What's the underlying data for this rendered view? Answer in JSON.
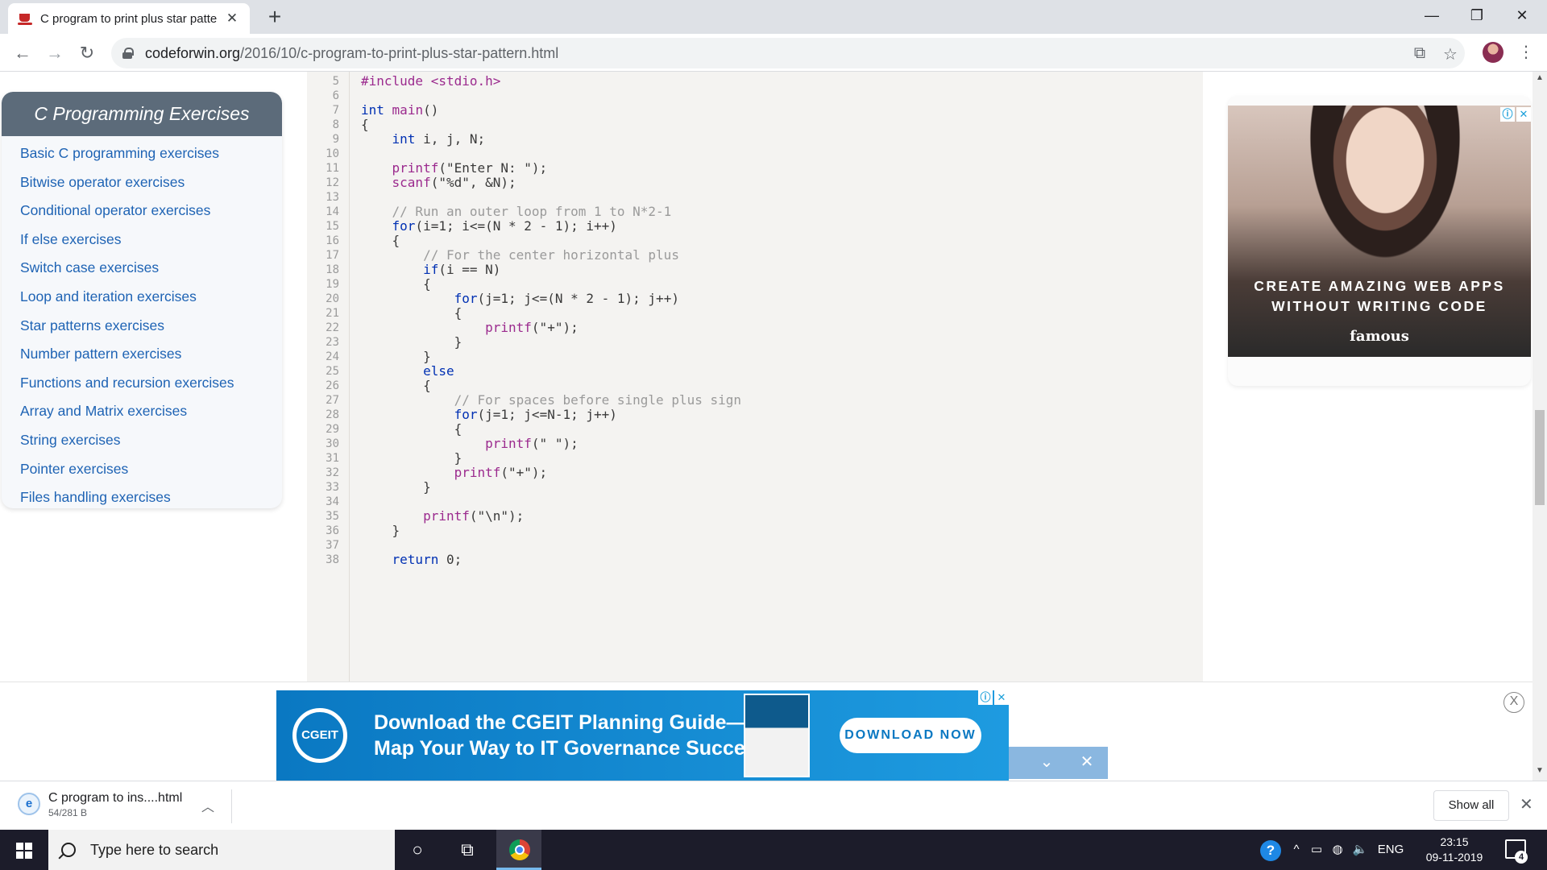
{
  "browser": {
    "tab_title": "C program to print plus star patte",
    "new_tab": "+",
    "url_domain": "codeforwin.org",
    "url_path": "/2016/10/c-program-to-print-plus-star-pattern.html",
    "minimize": "—",
    "maximize": "❐",
    "close": "✕"
  },
  "sidebar": {
    "title": "C Programming Exercises",
    "items": [
      {
        "label": "Basic C programming exercises"
      },
      {
        "label": "Bitwise operator exercises"
      },
      {
        "label": "Conditional operator exercises"
      },
      {
        "label": "If else exercises"
      },
      {
        "label": "Switch case exercises"
      },
      {
        "label": "Loop and iteration exercises"
      },
      {
        "label": "Star patterns exercises"
      },
      {
        "label": "Number pattern exercises"
      },
      {
        "label": "Functions and recursion exercises"
      },
      {
        "label": "Array and Matrix exercises"
      },
      {
        "label": "String exercises"
      },
      {
        "label": "Pointer exercises"
      },
      {
        "label": "Files handling exercises"
      }
    ]
  },
  "code": {
    "lines": [
      {
        "n": "5",
        "text": "#include <stdio.h>",
        "kind": "fn"
      },
      {
        "n": "6",
        "text": "",
        "kind": "plain"
      },
      {
        "n": "7",
        "text": "int main()",
        "kind": "main"
      },
      {
        "n": "8",
        "text": "{",
        "kind": "plain"
      },
      {
        "n": "9",
        "text": "    int i, j, N;",
        "kind": "decl"
      },
      {
        "n": "10",
        "text": "",
        "kind": "plain"
      },
      {
        "n": "11",
        "text": "    printf(\"Enter N: \");",
        "kind": "call"
      },
      {
        "n": "12",
        "text": "    scanf(\"%d\", &N);",
        "kind": "call"
      },
      {
        "n": "13",
        "text": "",
        "kind": "plain"
      },
      {
        "n": "14",
        "text": "    // Run an outer loop from 1 to N*2-1",
        "kind": "cm"
      },
      {
        "n": "15",
        "text": "    for(i=1; i<=(N * 2 - 1); i++)",
        "kind": "kwline"
      },
      {
        "n": "16",
        "text": "    {",
        "kind": "plain"
      },
      {
        "n": "17",
        "text": "        // For the center horizontal plus",
        "kind": "cm"
      },
      {
        "n": "18",
        "text": "        if(i == N)",
        "kind": "kwline"
      },
      {
        "n": "19",
        "text": "        {",
        "kind": "plain"
      },
      {
        "n": "20",
        "text": "            for(j=1; j<=(N * 2 - 1); j++)",
        "kind": "kwline"
      },
      {
        "n": "21",
        "text": "            {",
        "kind": "plain"
      },
      {
        "n": "22",
        "text": "                printf(\"+\");",
        "kind": "call"
      },
      {
        "n": "23",
        "text": "            }",
        "kind": "plain"
      },
      {
        "n": "24",
        "text": "        }",
        "kind": "plain"
      },
      {
        "n": "25",
        "text": "        else",
        "kind": "kwline"
      },
      {
        "n": "26",
        "text": "        {",
        "kind": "plain"
      },
      {
        "n": "27",
        "text": "            // For spaces before single plus sign",
        "kind": "cm"
      },
      {
        "n": "28",
        "text": "            for(j=1; j<=N-1; j++)",
        "kind": "kwline"
      },
      {
        "n": "29",
        "text": "            {",
        "kind": "plain"
      },
      {
        "n": "30",
        "text": "                printf(\" \");",
        "kind": "call"
      },
      {
        "n": "31",
        "text": "            }",
        "kind": "plain"
      },
      {
        "n": "32",
        "text": "            printf(\"+\");",
        "kind": "call"
      },
      {
        "n": "33",
        "text": "        }",
        "kind": "plain"
      },
      {
        "n": "34",
        "text": "",
        "kind": "plain"
      },
      {
        "n": "35",
        "text": "        printf(\"\\n\");",
        "kind": "call"
      },
      {
        "n": "36",
        "text": "    }",
        "kind": "plain"
      },
      {
        "n": "37",
        "text": "",
        "kind": "plain"
      },
      {
        "n": "38",
        "text": "    return 0;",
        "kind": "ret"
      }
    ]
  },
  "ad_right": {
    "headline_1": "CREATE AMAZING WEB APPS",
    "headline_2": "WITHOUT WRITING CODE",
    "brand": "famous"
  },
  "ad_bottom": {
    "logo": "CGEIT",
    "headline_1": "Download the CGEIT Planning Guide—",
    "headline_2": "Map Your Way to IT Governance Success!",
    "button": "DOWNLOAD NOW",
    "close": "X"
  },
  "download": {
    "file_name": "C program to ins....html",
    "file_size": "54/281 B",
    "show_all": "Show all"
  },
  "taskbar": {
    "search_placeholder": "Type here to search",
    "language": "ENG",
    "time": "23:15",
    "date": "09-11-2019",
    "notification_count": "4"
  },
  "colors": {
    "link": "#1e63b4",
    "sidebar_header": "#5c6b7a",
    "keyword": "#0030b3",
    "function": "#9b2a8e",
    "comment": "#9a9a9a",
    "banner_blue": "#0a78c2"
  }
}
